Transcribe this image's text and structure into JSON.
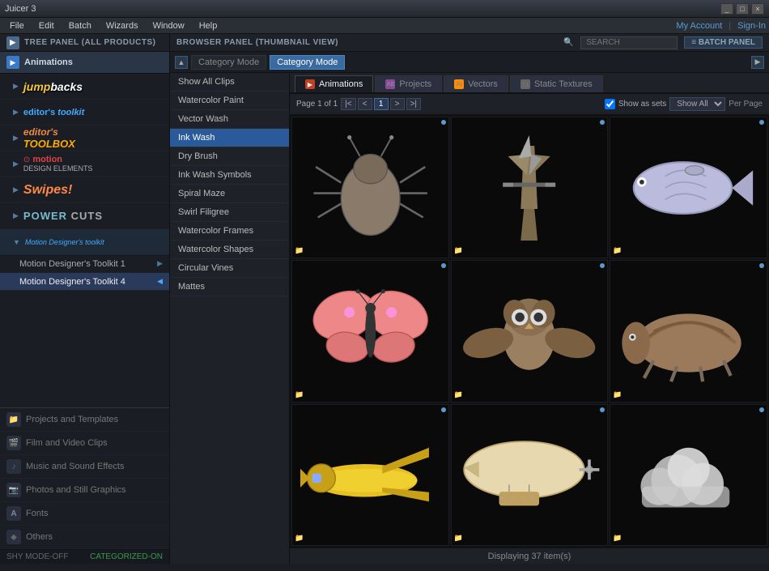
{
  "app": {
    "title": "Juicer 3",
    "win_controls": [
      "_",
      "□",
      "×"
    ]
  },
  "menu": {
    "items": [
      "File",
      "Edit",
      "Batch",
      "Wizards",
      "Window",
      "Help"
    ],
    "my_account": "My Account",
    "sign_in": "Sign-In"
  },
  "panel_headers": {
    "left": "TREE PANEL (ALL PRODUCTS)",
    "right": "BROWSER PANEL (THUMBNAIL VIEW)",
    "search_placeholder": "SEARCH",
    "batch_label": "≡ BATCH PANEL"
  },
  "sidebar": {
    "section_label": "Animations",
    "brands": [
      {
        "id": "jumpbacks",
        "label": "jump backs",
        "style": "jumpbacks"
      },
      {
        "id": "editors-toolkit",
        "label": "editor's toolkit",
        "style": "editors-tk"
      },
      {
        "id": "editors-toolbox",
        "label": "editor's TOOLBOX",
        "style": "editors-box"
      },
      {
        "id": "motion-design",
        "label": "motion DESIGN ELEMENTS",
        "style": "motion-de"
      },
      {
        "id": "swipes",
        "label": "Swipes!",
        "style": "swipes"
      },
      {
        "id": "power-cuts",
        "label": "POWER CUTS",
        "style": "power-cuts"
      },
      {
        "id": "mdt",
        "label": "Motion Designer's toolkit",
        "style": "mdt"
      }
    ],
    "sub_items": [
      {
        "id": "mdt-1",
        "label": "Motion Designer's Toolkit 1",
        "active": false
      },
      {
        "id": "mdt-4",
        "label": "Motion Designer's Toolkit 4",
        "active": true
      }
    ],
    "nav_items": [
      {
        "id": "projects",
        "label": "Projects and Templates",
        "icon": "📁"
      },
      {
        "id": "film",
        "label": "Film and Video Clips",
        "icon": "🎬"
      },
      {
        "id": "music",
        "label": "Music and Sound Effects",
        "icon": "🎵"
      },
      {
        "id": "photos",
        "label": "Photos and Still Graphics",
        "icon": "📷"
      },
      {
        "id": "fonts",
        "label": "Fonts",
        "icon": "A"
      },
      {
        "id": "others",
        "label": "Others",
        "icon": "◆"
      }
    ],
    "status_left": "SHY MODE-OFF",
    "status_right": "CATEGORIZED-ON"
  },
  "category_bar": {
    "label": "Category Mode",
    "active": "Category Mode"
  },
  "categories": [
    {
      "id": "show-all",
      "label": "Show All Clips",
      "active": false
    },
    {
      "id": "watercolor-paint",
      "label": "Watercolor Paint",
      "active": false
    },
    {
      "id": "vector-wash",
      "label": "Vector Wash",
      "active": false
    },
    {
      "id": "ink-wash",
      "label": "Ink Wash",
      "active": true
    },
    {
      "id": "dry-brush",
      "label": "Dry Brush",
      "active": false
    },
    {
      "id": "ink-wash-sym",
      "label": "Ink Wash Symbols",
      "active": false
    },
    {
      "id": "spiral-maze",
      "label": "Spiral Maze",
      "active": false
    },
    {
      "id": "swirl-filigree",
      "label": "Swirl Filigree",
      "active": false
    },
    {
      "id": "watercolor-frames",
      "label": "Watercolor Frames",
      "active": false
    },
    {
      "id": "watercolor-shapes",
      "label": "Watercolor Shapes",
      "active": false
    },
    {
      "id": "circular-vines",
      "label": "Circular Vines",
      "active": false
    },
    {
      "id": "mattes",
      "label": "Mattes",
      "active": false
    }
  ],
  "tabs": [
    {
      "id": "animations",
      "label": "Animations",
      "icon": "▶",
      "color": "#c04020",
      "active": true
    },
    {
      "id": "projects",
      "label": "Projects",
      "icon": "AE",
      "color": "#8a4a9a",
      "active": false
    },
    {
      "id": "vectors",
      "label": "Vectors",
      "icon": "Ai",
      "color": "#ff8c00",
      "active": false
    },
    {
      "id": "static",
      "label": "Static Textures",
      "icon": "□",
      "color": "#666",
      "active": false
    }
  ],
  "controls": {
    "page_info": "Page 1 of 1",
    "nav_first": "|<",
    "nav_prev": "<",
    "nav_current": "1",
    "nav_next": ">",
    "nav_last": ">|",
    "show_as_sets": "Show as sets",
    "show_all": "Show All",
    "per_page": "Per Page"
  },
  "thumbnails": [
    {
      "id": "bug",
      "desc": "Beetle/Bug animation",
      "has_indicator": true
    },
    {
      "id": "windmill",
      "desc": "Windmill animation",
      "has_indicator": true
    },
    {
      "id": "fish",
      "desc": "Fish animation",
      "has_indicator": true
    },
    {
      "id": "butterfly",
      "desc": "Butterfly animation",
      "has_indicator": true
    },
    {
      "id": "owl",
      "desc": "Owl animation",
      "has_indicator": true
    },
    {
      "id": "armadillo",
      "desc": "Armadillo animation",
      "has_indicator": true
    },
    {
      "id": "plane",
      "desc": "Yellow airplane animation",
      "has_indicator": true
    },
    {
      "id": "blimp",
      "desc": "Blimp/Airship animation",
      "has_indicator": true
    },
    {
      "id": "cloud",
      "desc": "Cloud animation",
      "has_indicator": true
    }
  ],
  "status": {
    "displaying": "Displaying 37 item(s)"
  }
}
